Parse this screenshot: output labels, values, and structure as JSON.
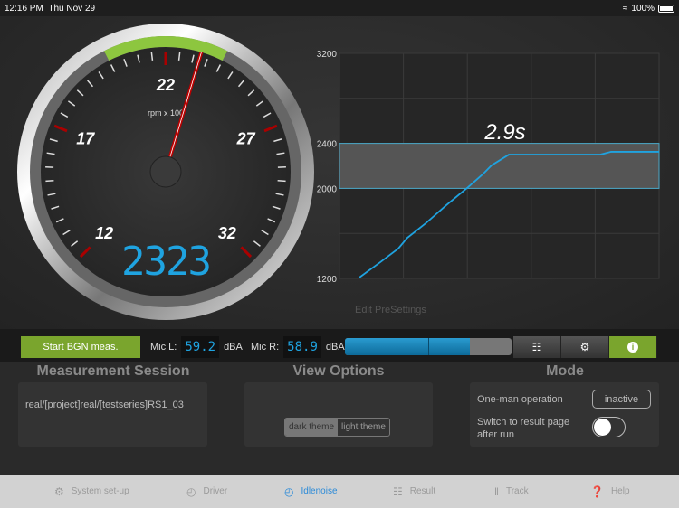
{
  "status": {
    "time": "12:16 PM",
    "date": "Thu Nov 29",
    "battery": "100%"
  },
  "gauge": {
    "unit_label": "rpm x 100",
    "value": "2323",
    "needle_value": 23.23,
    "labels": [
      "12",
      "17",
      "22",
      "27",
      "32"
    ],
    "min": 12,
    "max": 32,
    "green_range": [
      20,
      24
    ],
    "accent": "#8dc63f",
    "display_color": "#1fa3e0"
  },
  "chart_data": {
    "type": "line",
    "title": "2.9s",
    "ylim": [
      1200,
      3200
    ],
    "yticks": [
      "1200",
      "2000",
      "2400",
      "3200"
    ],
    "xlim": [
      0,
      5
    ],
    "band": [
      2000,
      2400
    ],
    "grid": true,
    "color": "#1fa3e0",
    "x": [
      0.31,
      0.64,
      0.92,
      1.06,
      1.35,
      1.67,
      2.01,
      2.24,
      2.38,
      2.65,
      4.08,
      4.25,
      5.0
    ],
    "y": [
      1208,
      1345,
      1465,
      1560,
      1690,
      1850,
      2010,
      2125,
      2205,
      2300,
      2300,
      2325,
      2325
    ]
  },
  "edit_presettings": "Edit PreSettings",
  "controls": {
    "start_label": "Start BGN meas.",
    "mic_l_label": "Mic L:",
    "mic_l_value": "59.2",
    "mic_r_label": "Mic R:",
    "mic_r_value": "58.9",
    "unit": "dBA",
    "level_fraction": 0.75
  },
  "session": {
    "title": "Measurement Session",
    "path": "real/[project]real/[testseries]RS1_03"
  },
  "view": {
    "title": "View Options",
    "dark": "dark theme",
    "light": "light theme"
  },
  "mode": {
    "title": "Mode",
    "one_man": "One-man operation",
    "one_man_state": "inactive",
    "switch_label": "Switch to result page after run",
    "switch_on": false
  },
  "tabs": [
    {
      "label": "System set-up",
      "icon": "gears-icon"
    },
    {
      "label": "Driver",
      "icon": "gauge-icon"
    },
    {
      "label": "Idlenoise",
      "icon": "gauge-icon",
      "active": true
    },
    {
      "label": "Result",
      "icon": "sliders-icon"
    },
    {
      "label": "Track",
      "icon": "track-icon"
    },
    {
      "label": "Help",
      "icon": "help-icon"
    }
  ]
}
